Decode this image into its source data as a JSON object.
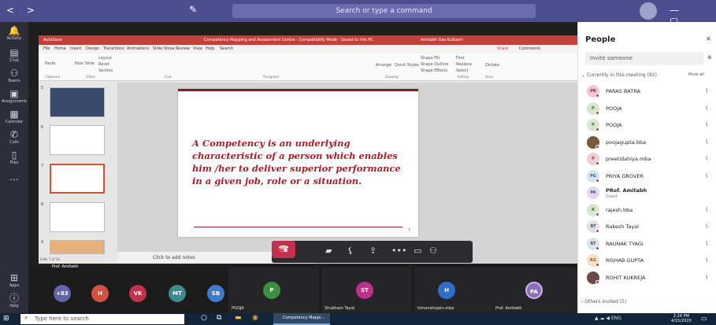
{
  "titlebar": {
    "nav": "< >",
    "edit_icon": "edit-icon",
    "search_placeholder": "Search or type a command",
    "window_controls": "— ▢"
  },
  "appbar": {
    "items": [
      {
        "label": "Activity",
        "icon": "bell-icon"
      },
      {
        "label": "Chat",
        "icon": "chat-icon"
      },
      {
        "label": "Teams",
        "icon": "teams-icon"
      },
      {
        "label": "Assignments",
        "icon": "assignments-icon"
      },
      {
        "label": "Calendar",
        "icon": "calendar-icon"
      },
      {
        "label": "Calls",
        "icon": "phone-icon"
      },
      {
        "label": "Files",
        "icon": "file-icon"
      },
      {
        "label": "...",
        "icon": "more-icon"
      },
      {
        "label": "Apps",
        "icon": "apps-icon"
      },
      {
        "label": "Help",
        "icon": "help-icon"
      }
    ]
  },
  "ppt": {
    "title": "Competency Mapping and Assessment Centre - Compatibility Mode - Saved to this PC",
    "user": "Amitabh Das Kulkarni",
    "app": "AutoSave",
    "menu": [
      "File",
      "Home",
      "Insert",
      "Design",
      "Transitions",
      "Animations",
      "Slide Show",
      "Review",
      "View",
      "Help",
      "Search"
    ],
    "share": "Share",
    "comments": "Comments",
    "ribbon_groups": [
      "Clipboard",
      "Slides",
      "Font",
      "Paragraph",
      "Drawing",
      "Editing",
      "Voice"
    ],
    "ribbon_items": [
      "Paste",
      "New Slide",
      "Layout",
      "Reset",
      "Section",
      "Arrange",
      "Quick Styles",
      "Shape Fill",
      "Shape Outline",
      "Shape Effects",
      "Find",
      "Replace",
      "Select",
      "Dictate"
    ],
    "slide_numbers": [
      "5",
      "6",
      "7",
      "8",
      "9"
    ],
    "slide_text": "A Competency is an underlying characteristic of a person which enables him /her to deliver superior performance in a given job, role or a situation.",
    "slide_page": "7",
    "notes_placeholder": "Click to add notes",
    "status": "Slide 7 of 54"
  },
  "controls": [
    "record-icon",
    "video-off-icon",
    "mic-off-icon",
    "share-icon",
    "more-icon",
    "chat-icon",
    "people-icon",
    "hangup-icon"
  ],
  "strip": {
    "bubbles": [
      {
        "text": "+83",
        "color": "#6264a7"
      },
      {
        "text": "H",
        "color": "#d64f43"
      },
      {
        "text": "VK",
        "color": "#c4314b"
      },
      {
        "text": "MT",
        "color": "#3d8a8a"
      },
      {
        "text": "SB",
        "color": "#3d7cc9"
      },
      {
        "text": "P",
        "color": "#3e8e41"
      },
      {
        "text": "ST",
        "color": "#c02f8c"
      },
      {
        "text": "H",
        "color": "#2f6ec9"
      },
      {
        "text": "PA",
        "color": "#8e6db8"
      }
    ],
    "names": [
      "Prof. Amitabh",
      "POOJA",
      "Shubham Tayal",
      "himanshujain.mba",
      "Prof. Amitabh"
    ]
  },
  "people": {
    "title": "People",
    "invite": "Invite someone",
    "section": "Currently in this meeting (92)",
    "mute_all": "Mute all",
    "others": "Others invited (5)",
    "list": [
      {
        "initials": "PB",
        "name": "PARAS BATRA",
        "color": "#f3c8d3",
        "text": "#8e2f4f",
        "sub": ""
      },
      {
        "initials": "P",
        "name": "POOJA",
        "color": "#d7e7d0",
        "text": "#3c6e28",
        "sub": ""
      },
      {
        "initials": "P",
        "name": "POOJA",
        "color": "#d7e7d0",
        "text": "#3c6e28",
        "sub": ""
      },
      {
        "initials": "",
        "name": "poojagupta.bba",
        "color": "#7a5a3a",
        "text": "#fff",
        "sub": ""
      },
      {
        "initials": "P",
        "name": "preetidahiya.mba",
        "color": "#f5cdd4",
        "text": "#b03050",
        "sub": ""
      },
      {
        "initials": "PG",
        "name": "PRIYA GROVER",
        "color": "#d4e6f1",
        "text": "#2f5f8a",
        "sub": ""
      },
      {
        "initials": "PA",
        "name": "PRof. Amitabh",
        "color": "#e3d8f1",
        "text": "#5f3f8f",
        "sub": "Guest"
      },
      {
        "initials": "R",
        "name": "rajesh.bba",
        "color": "#d7e7d0",
        "text": "#3c6e28",
        "sub": ""
      },
      {
        "initials": "RT",
        "name": "Rakesh Tayal",
        "color": "#dde3ea",
        "text": "#3f4f60",
        "sub": ""
      },
      {
        "initials": "RT",
        "name": "RAUNAK TYAGI",
        "color": "#dde3ea",
        "text": "#3f4f60",
        "sub": ""
      },
      {
        "initials": "RG",
        "name": "RISHAB GUPTA",
        "color": "#f8e0c8",
        "text": "#a3561d",
        "sub": ""
      },
      {
        "initials": "",
        "name": "ROHIT KUKREJA",
        "color": "#6a4a4a",
        "text": "#fff",
        "sub": ""
      }
    ]
  },
  "taskbar": {
    "search": "Type here to search",
    "app": "Competency Mappi...",
    "tray": "ENG",
    "time": "2:24 PM",
    "date": "4/15/2020"
  }
}
